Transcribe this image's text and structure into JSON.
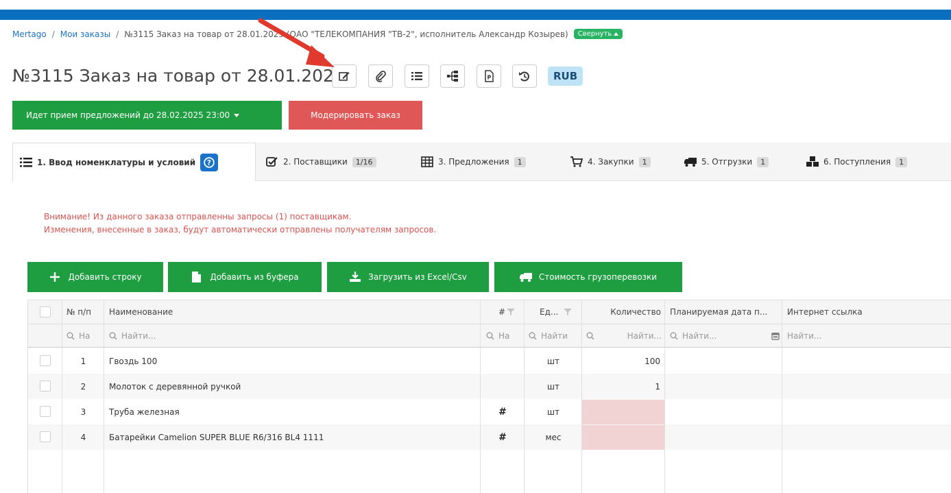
{
  "breadcrumb": {
    "home": "Mertago",
    "sep1": "/",
    "orders": "Мои заказы",
    "sep2": "/",
    "current": "№3115 Заказ на товар от 28.01.2025 (ОАО \"ТЕЛЕКОМПАНИЯ \"ТВ-2\", исполнитель Александр Козырев)",
    "collapse_label": "Свернуть"
  },
  "title": "№3115 Заказ на товар от 28.01.2025",
  "currency": "RUB",
  "status_button": "Идет прием предложений до 28.02.2025 23:00",
  "moderate_button": "Модерировать заказ",
  "tabs": [
    {
      "label": "1. Ввод номенклатуры и условий",
      "count": ""
    },
    {
      "label": "2. Поставщики",
      "count": "1/16"
    },
    {
      "label": "3. Предложения",
      "count": "1"
    },
    {
      "label": "4. Закупки",
      "count": "1"
    },
    {
      "label": "5. Отгрузки",
      "count": "1"
    },
    {
      "label": "6. Поступления",
      "count": "1"
    }
  ],
  "warning": {
    "line1": "Внимание! Из данного заказа отправленны запросы (1) поставщикам.",
    "line2": "Изменения, внесенные в заказ, будут автоматически отправлены получателям запросов."
  },
  "actions": {
    "add_row": "Добавить строку",
    "add_from_buffer": "Добавить из буфера",
    "load_excel": "Загрузить из Excel/Csv",
    "freight_cost": "Стоимость грузоперевозки"
  },
  "table": {
    "headers": {
      "num": "№ п/п",
      "name": "Наименование",
      "hash": "#",
      "unit": "Ед...",
      "qty": "Количество",
      "date": "Планируемая дата п...",
      "link": "Интернет ссылка"
    },
    "filters": {
      "num": "На",
      "name": "Найти...",
      "hash": "На",
      "unit": "Найти",
      "qty": "Найти...",
      "date": "Найти...",
      "link": "Найти..."
    },
    "rows": [
      {
        "num": "1",
        "name": "Гвоздь 100",
        "hash": "",
        "unit": "шт",
        "qty": "100"
      },
      {
        "num": "2",
        "name": "Молоток с деревянной ручкой",
        "hash": "",
        "unit": "шт",
        "qty": "1"
      },
      {
        "num": "3",
        "name": "Труба железная",
        "hash": "#",
        "unit": "шт",
        "qty": ""
      },
      {
        "num": "4",
        "name": "Батарейки Camelion SUPER BLUE R6/316 BL4 1111",
        "hash": "#",
        "unit": "мес",
        "qty": ""
      }
    ]
  },
  "colors": {
    "header_blue": "#0a6fbf",
    "primary_green": "#1e9e40",
    "danger_red": "#e05757",
    "warning_text": "#d9534f",
    "empty_qty": "#f2d3d3"
  }
}
